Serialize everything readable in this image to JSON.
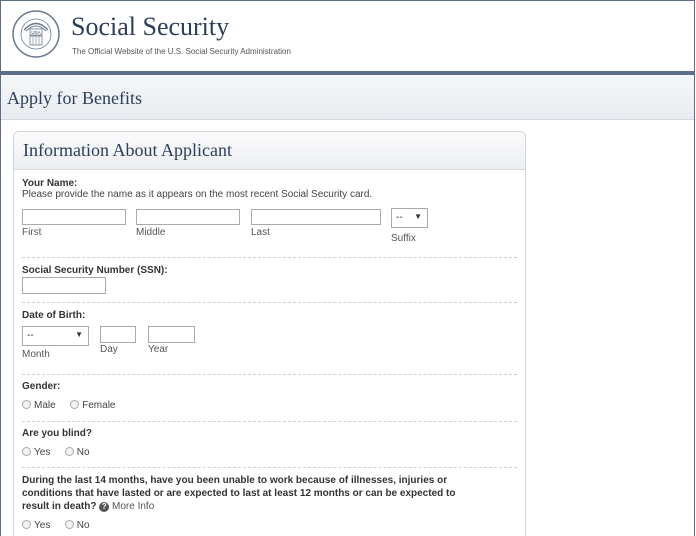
{
  "header": {
    "title": "Social Security",
    "subtitle": "The Official Website of the U.S. Social Security Administration",
    "seal_text_top": "SOCIAL SECURITY",
    "seal_text_bottom": "ADMINISTRATION",
    "seal_text_center": "USA"
  },
  "subheader": {
    "title": "Apply for Benefits"
  },
  "panel": {
    "title": "Information About Applicant",
    "name": {
      "label": "Your Name:",
      "hint": "Please provide the name as it appears on the most recent Social Security card.",
      "first_caption": "First",
      "middle_caption": "Middle",
      "last_caption": "Last",
      "suffix_value": "--",
      "suffix_caption": "Suffix"
    },
    "ssn": {
      "label": "Social Security Number (SSN):"
    },
    "dob": {
      "label": "Date of Birth:",
      "month_value": "--",
      "month_caption": "Month",
      "day_caption": "Day",
      "year_caption": "Year"
    },
    "gender": {
      "label": "Gender:",
      "options": [
        "Male",
        "Female"
      ]
    },
    "blind": {
      "label": "Are you blind?",
      "options": [
        "Yes",
        "No"
      ]
    },
    "unable": {
      "line1": "During the last 14 months, have you been unable to work because of illnesses, injuries or",
      "line2": "conditions that have lasted or are expected to last at least 12 months or can be expected to",
      "line3": "result in death?",
      "help_icon": "?",
      "more_info": "More Info",
      "options": [
        "Yes",
        "No"
      ]
    }
  }
}
